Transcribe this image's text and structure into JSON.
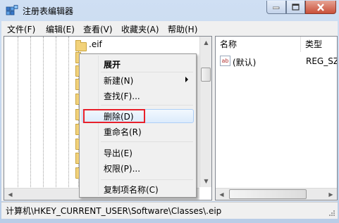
{
  "window": {
    "title": "注册表编辑器"
  },
  "menubar": {
    "file": "文件(F)",
    "edit": "编辑(E)",
    "view": "查看(V)",
    "favorites": "收藏夹(A)",
    "help": "帮助(H)"
  },
  "tree": {
    "visible_item": ".eif"
  },
  "list": {
    "col_name": "名称",
    "col_type": "类型",
    "rows": [
      {
        "name": "(默认)",
        "type": "REG_SZ"
      }
    ]
  },
  "context_menu": {
    "expand": "展开",
    "new": "新建(N)",
    "find": "查找(F)...",
    "delete": "删除(D)",
    "rename": "重命名(R)",
    "export": "导出(E)",
    "permissions": "权限(P)...",
    "copy_key_name": "复制项名称(C)"
  },
  "status": {
    "path": "计算机\\HKEY_CURRENT_USER\\Software\\Classes\\.eip"
  },
  "colors": {
    "highlight_box": "#e8202a",
    "selection": "#dcebfc"
  }
}
